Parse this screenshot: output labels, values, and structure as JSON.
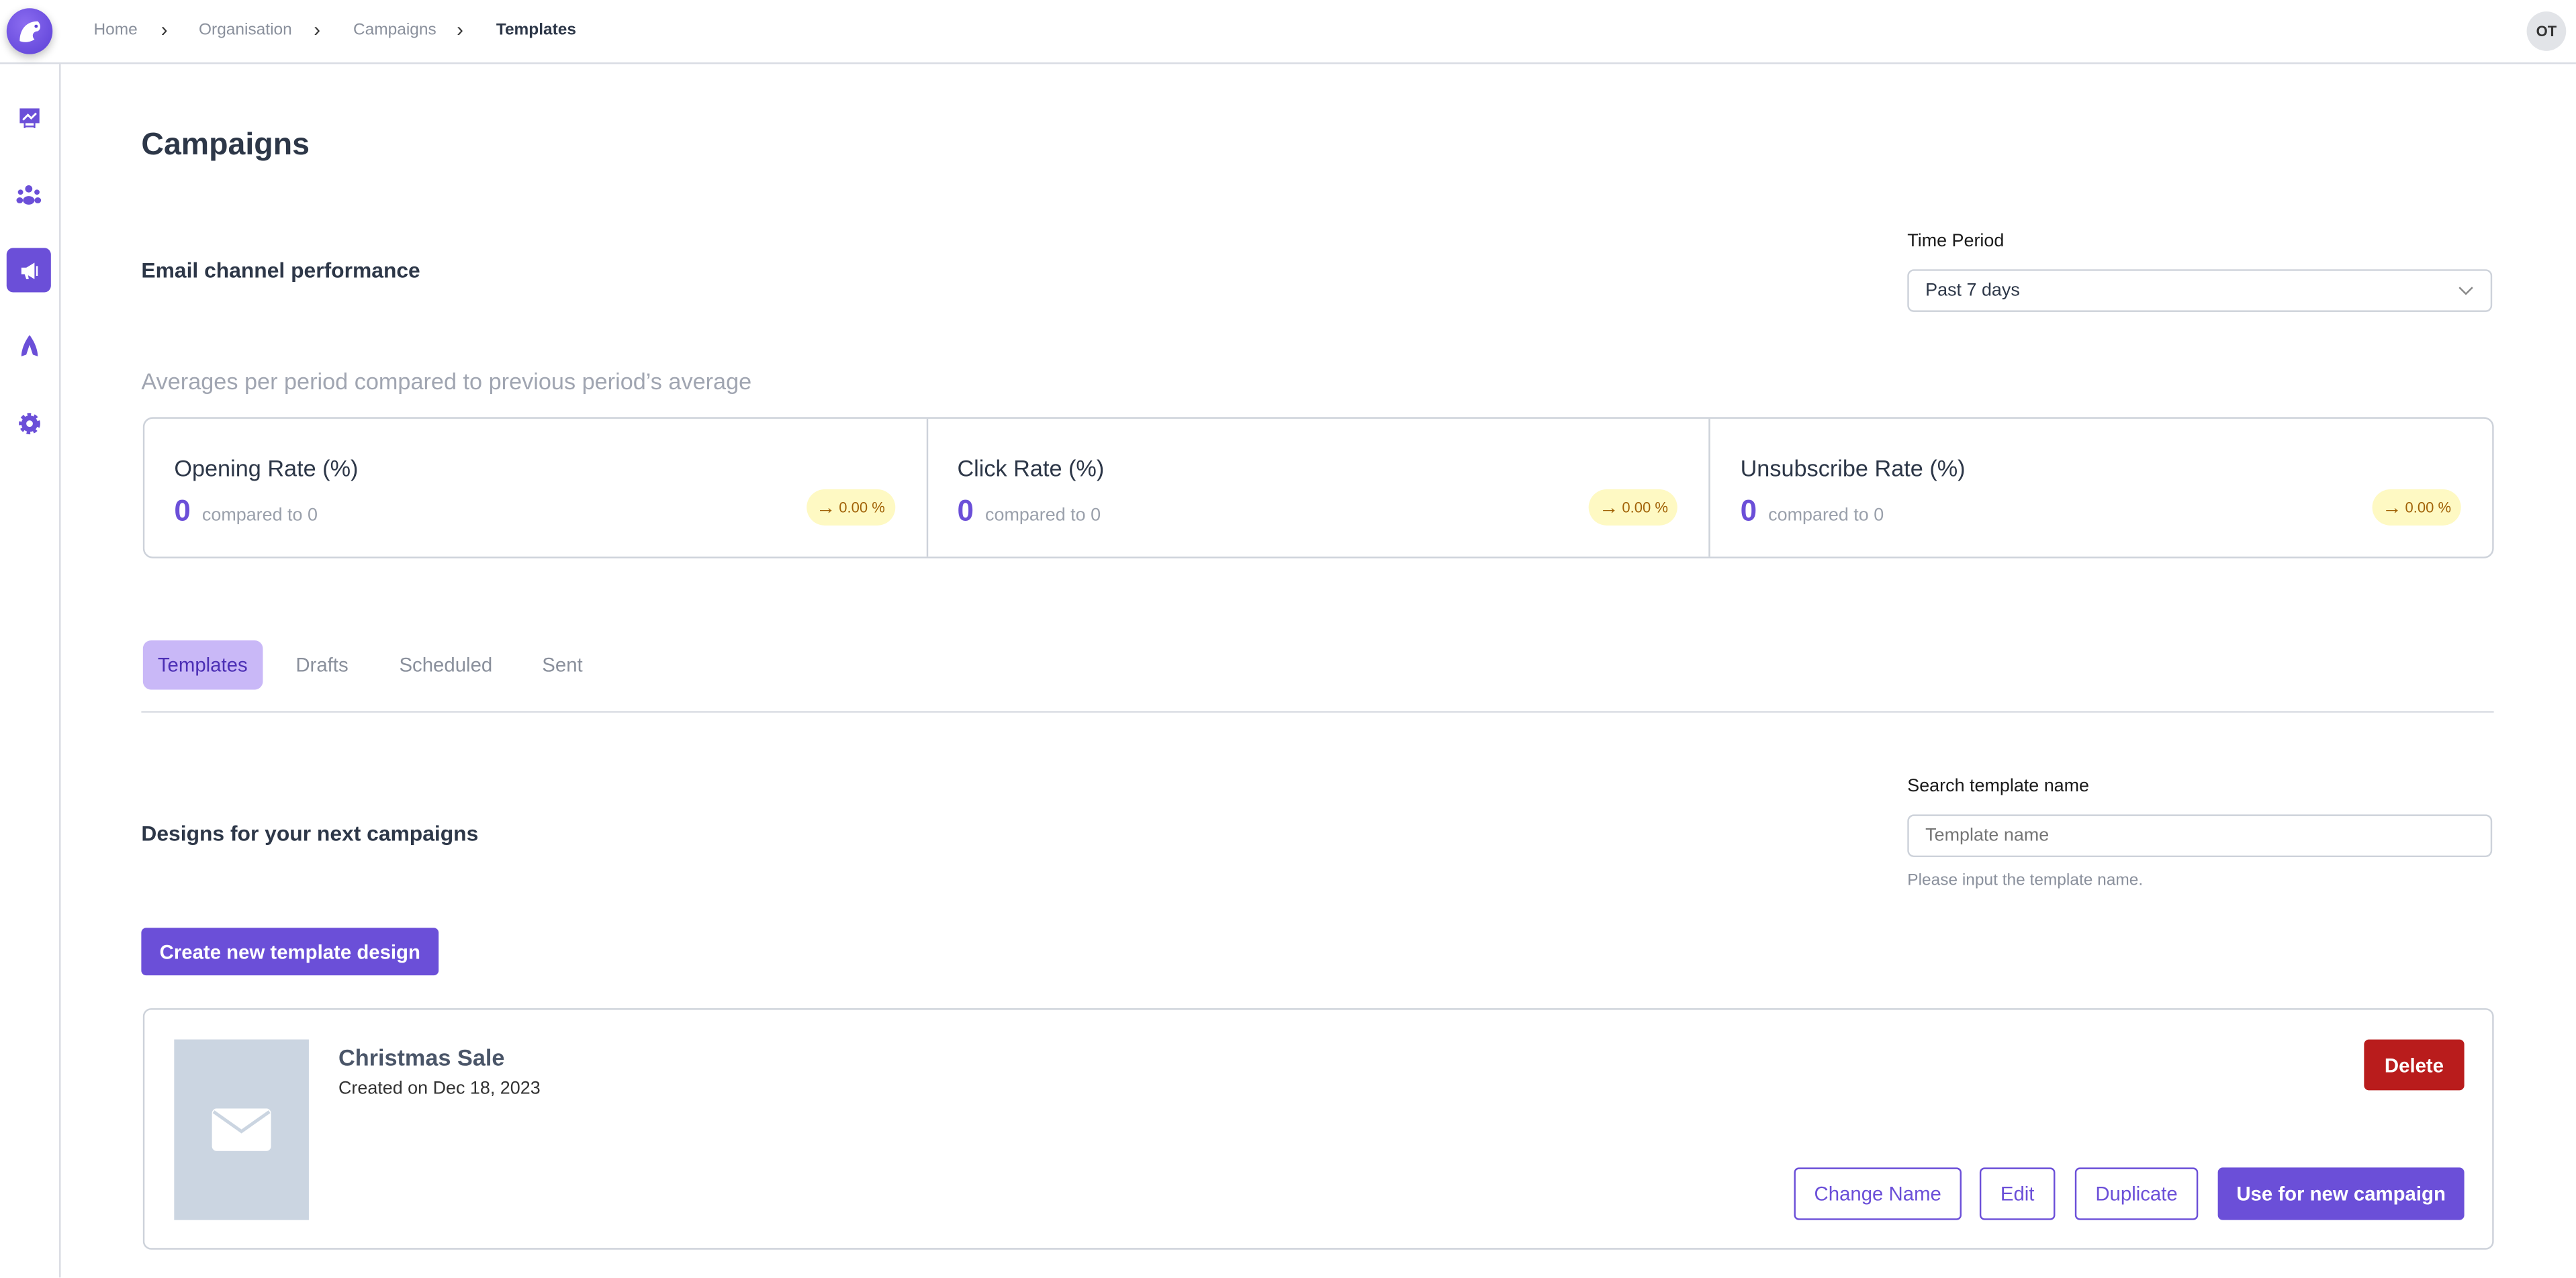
{
  "breadcrumb": [
    "Home",
    "Organisation",
    "Campaigns",
    "Templates"
  ],
  "user": {
    "initials": "OT"
  },
  "sidebar": {
    "items": [
      {
        "icon": "presentation-chart-icon"
      },
      {
        "icon": "users-icon"
      },
      {
        "icon": "megaphone-icon",
        "active": true
      },
      {
        "icon": "rocket-icon"
      },
      {
        "icon": "gear-icon"
      }
    ]
  },
  "page": {
    "title": "Campaigns"
  },
  "performance": {
    "title": "Email channel performance",
    "time_period_label": "Time Period",
    "time_period_value": "Past 7 days",
    "subtitle": "Averages per period compared to previous period’s average",
    "stats": [
      {
        "title": "Opening Rate (%)",
        "value": "0",
        "compared": "compared to 0",
        "change": "0.00 %"
      },
      {
        "title": "Click Rate (%)",
        "value": "0",
        "compared": "compared to 0",
        "change": "0.00 %"
      },
      {
        "title": "Unsubscribe Rate (%)",
        "value": "0",
        "compared": "compared to 0",
        "change": "0.00 %"
      }
    ]
  },
  "tabs": [
    "Templates",
    "Drafts",
    "Scheduled",
    "Sent"
  ],
  "templates": {
    "title": "Designs for your next campaigns",
    "search_label": "Search template name",
    "search_placeholder": "Template name",
    "search_help": "Please input the template name.",
    "create_label": "Create new template design",
    "items": [
      {
        "name": "Christmas Sale",
        "created": "Created on Dec 18, 2023",
        "delete": "Delete",
        "change_name": "Change Name",
        "edit": "Edit",
        "duplicate": "Duplicate",
        "use": "Use for new campaign"
      }
    ]
  },
  "colors": {
    "accent": "#6b4fd8",
    "danger": "#b91c1c",
    "badge_bg": "#fef9c3",
    "badge_text": "#a16207"
  }
}
